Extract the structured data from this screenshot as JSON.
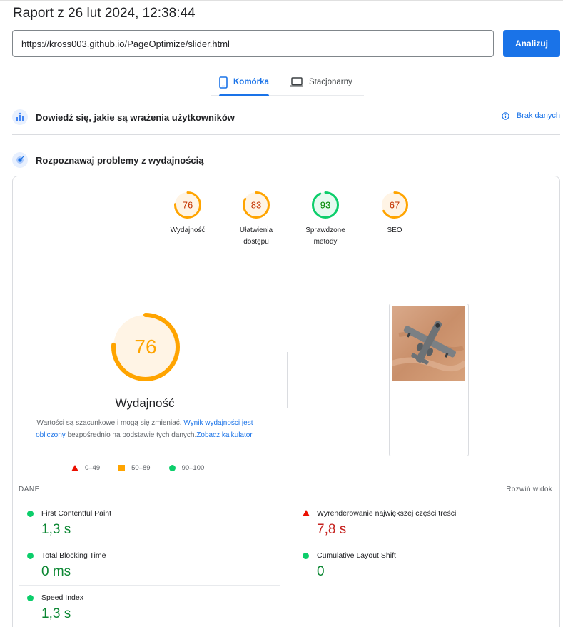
{
  "report": {
    "title": "Raport z 26 lut 2024, 12:38:44"
  },
  "search": {
    "url": "https://kross003.github.io/PageOptimize/slider.html",
    "analyze_label": "Analizuj"
  },
  "tabs": [
    {
      "label": "Komórka",
      "icon": "mobile-icon",
      "active": true
    },
    {
      "label": "Stacjonarny",
      "icon": "desktop-icon",
      "active": false
    }
  ],
  "ux_section": {
    "title": "Dowiedź się, jakie są wrażenia użytkowników",
    "no_data_label": "Brak danych",
    "icon": "users-chart-icon"
  },
  "perf_section": {
    "title": "Rozpoznawaj problemy z wydajnością",
    "icon": "lighthouse-icon"
  },
  "scores": [
    {
      "value": "76",
      "label_line1": "Wydajność",
      "label_line2": "",
      "color": "#ffa400",
      "text_color": "#c33300",
      "fraction": 0.76
    },
    {
      "value": "83",
      "label_line1": "Ułatwienia",
      "label_line2": "dostępu",
      "color": "#ffa400",
      "text_color": "#c33300",
      "fraction": 0.83
    },
    {
      "value": "93",
      "label_line1": "Sprawdzone",
      "label_line2": "metody",
      "color": "#0cce6b",
      "text_color": "#008800",
      "fraction": 0.93
    },
    {
      "value": "67",
      "label_line1": "SEO",
      "label_line2": "",
      "color": "#ffa400",
      "text_color": "#c33300",
      "fraction": 0.67
    }
  ],
  "performance": {
    "score": "76",
    "fraction": 0.76,
    "label": "Wydajność",
    "desc_1": "Wartości są szacunkowe i mogą się zmieniać.",
    "link_1": "Wynik wydajności jest obliczony",
    "desc_2": "bezpośrednio na podstawie tych danych.",
    "link_2": "Zobacz kalkulator."
  },
  "legend": [
    {
      "range": "0–49",
      "shape": "triangle",
      "color": "#eb0f00"
    },
    {
      "range": "50–89",
      "shape": "square",
      "color": "#ffa400"
    },
    {
      "range": "90–100",
      "shape": "circle",
      "color": "#0cce6b"
    }
  ],
  "metrics_header": {
    "title": "DANE",
    "expand_label": "Rozwiń widok"
  },
  "metrics": [
    {
      "name": "First Contentful Paint",
      "value": "1,3 s",
      "status": "good"
    },
    {
      "name": "Wyrenderowanie największej części treści",
      "value": "7,8 s",
      "status": "bad"
    },
    {
      "name": "Total Blocking Time",
      "value": "0 ms",
      "status": "good"
    },
    {
      "name": "Cumulative Layout Shift",
      "value": "0",
      "status": "good"
    },
    {
      "name": "Speed Index",
      "value": "1,3 s",
      "status": "good"
    }
  ]
}
